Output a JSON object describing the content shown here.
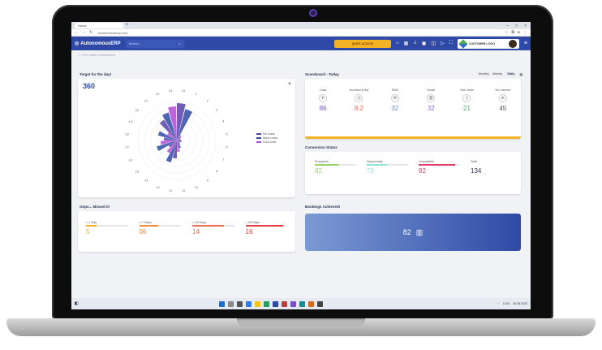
{
  "browser": {
    "tab_title": "Home",
    "tab_plus": "+",
    "url": "autonomouserp.com",
    "win_controls": [
      "–",
      "□",
      "×"
    ]
  },
  "header": {
    "logo": "AutonomousERP",
    "search_placeholder": "Search...",
    "quick_access": "QUICK ACCESS",
    "customer_logo": "CUSTOMER LOGO"
  },
  "breadcrumb": "⌂ / Pre Sales / Dashboard",
  "target": {
    "title": "Target for the day!",
    "value": "360",
    "plus": "+",
    "legend": [
      "Hot Leads",
      "Warm Leads",
      "Cold Leads"
    ],
    "legend_colors": [
      "#5a3fa8",
      "#2f4aa6",
      "#b24ad6"
    ],
    "hours": [
      "24",
      "1",
      "2",
      "3",
      "4",
      "5",
      "6",
      "7",
      "8",
      "9",
      "10",
      "11",
      "12",
      "13",
      "14",
      "15",
      "16",
      "17",
      "18",
      "19",
      "20",
      "21",
      "22",
      "23"
    ]
  },
  "scoreboard": {
    "title": "Scoreboard - Today",
    "periods": [
      "Monthly",
      "Weekly",
      "Daily"
    ],
    "metrics": [
      {
        "label": "Calls",
        "value": "86",
        "color": "#7a4fc7",
        "icon": "phone-icon"
      },
      {
        "label": "Duration (Hrs)",
        "value": "8.2",
        "color": "#ef6b51",
        "icon": "timer-icon"
      },
      {
        "label": "SMS",
        "value": "32",
        "color": "#6a8ad8",
        "icon": "sms-icon"
      },
      {
        "label": "Email",
        "value": "32",
        "color": "#8a6ad8",
        "icon": "email-icon"
      },
      {
        "label": "Site Visits",
        "value": "21",
        "color": "#52b07c",
        "icon": "building-icon"
      },
      {
        "label": "No Interest",
        "value": "45",
        "color": "#555555",
        "icon": "block-icon"
      }
    ]
  },
  "conversion": {
    "title": "Conversion Status",
    "items": [
      {
        "label": "Prospects",
        "value": "82",
        "color": "#9ad36a",
        "fill": 0.6
      },
      {
        "label": "Opportunity",
        "value": "70",
        "color": "#8fe3d8",
        "fill": 0.5
      },
      {
        "label": "Unqualified",
        "value": "82",
        "color": "#e23c6b",
        "fill": 0.9
      },
      {
        "label": "Total",
        "value": "134",
        "color": "#2b3350",
        "fill": 0
      }
    ]
  },
  "oops": {
    "title": "Oops... Missed it!",
    "items": [
      {
        "label": "< 1 Day",
        "value": "5",
        "color": "#f4b325",
        "fill": 0.25
      },
      {
        "label": "< 7 Days",
        "value": "06",
        "color": "#f08a3b",
        "fill": 0.45
      },
      {
        "label": "< 15 Days",
        "value": "14",
        "color": "#ef6b51",
        "fill": 0.75
      },
      {
        "label": "< 30 Days",
        "value": "16",
        "color": "#e23c3c",
        "fill": 0.9
      }
    ]
  },
  "bookings": {
    "title": "Bookings Achieved!",
    "value": "82"
  },
  "tray": {
    "time": "11:04",
    "date": "28-08-2023"
  }
}
